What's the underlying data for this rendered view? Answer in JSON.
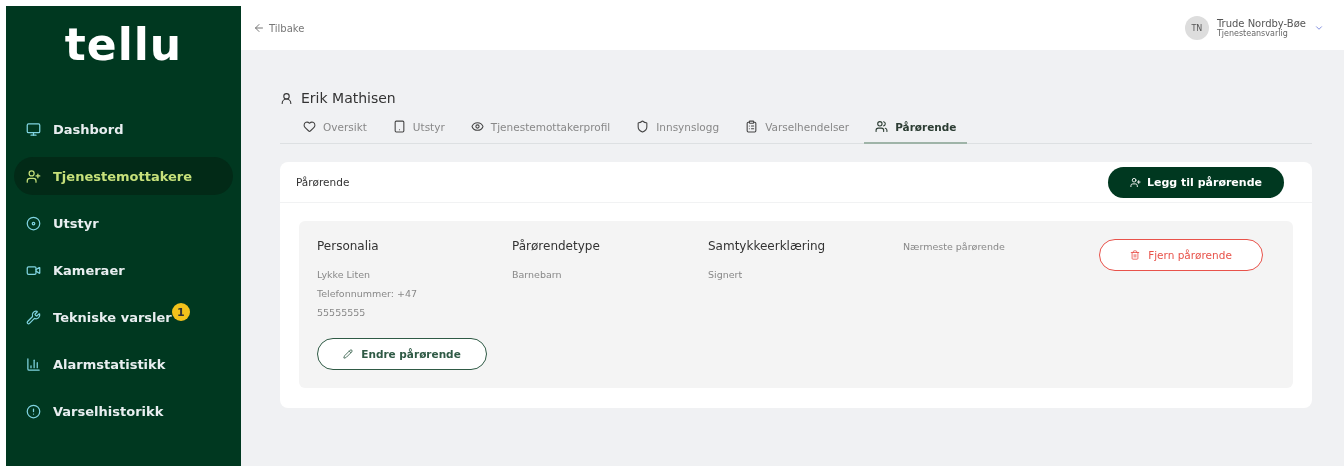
{
  "sidebar": {
    "logo": "tellu",
    "items": [
      {
        "label": "Dashbord",
        "selected": false
      },
      {
        "label": "Tjenestemottakere",
        "selected": true
      },
      {
        "label": "Utstyr",
        "selected": false
      },
      {
        "label": "Kameraer",
        "selected": false
      },
      {
        "label": "Tekniske varsler",
        "selected": false,
        "badge": "1"
      },
      {
        "label": "Alarmstatistikk",
        "selected": false
      },
      {
        "label": "Varselhistorikk",
        "selected": false
      }
    ]
  },
  "topbar": {
    "back": "Tilbake",
    "user": {
      "initials": "TN",
      "name": "Trude Nordby-Bøe",
      "role": "Tjenesteansvarlig"
    }
  },
  "client": {
    "name": "Erik Mathisen"
  },
  "tabs": [
    {
      "label": "Oversikt",
      "selected": false
    },
    {
      "label": "Utstyr",
      "selected": false
    },
    {
      "label": "Tjenestemottakerprofil",
      "selected": false
    },
    {
      "label": "Innsynslogg",
      "selected": false
    },
    {
      "label": "Varselhendelser",
      "selected": false
    },
    {
      "label": "Pårørende",
      "selected": true
    }
  ],
  "panel": {
    "title": "Pårørende",
    "add_button": "Legg til pårørende",
    "relatives": [
      {
        "columns": [
          {
            "heading": "Personalia",
            "lines": [
              "Lykke Liten",
              "Telefonnummer: +47 55555555"
            ]
          },
          {
            "heading": "Pårørendetype",
            "lines": [
              "Barnebarn"
            ]
          },
          {
            "heading": "Samtykkeerklæring",
            "lines": [
              "Signert"
            ]
          }
        ],
        "closest_label": "Nærmeste pårørende",
        "edit_button": "Endre pårørende",
        "remove_button": "Fjern pårørende"
      }
    ]
  }
}
